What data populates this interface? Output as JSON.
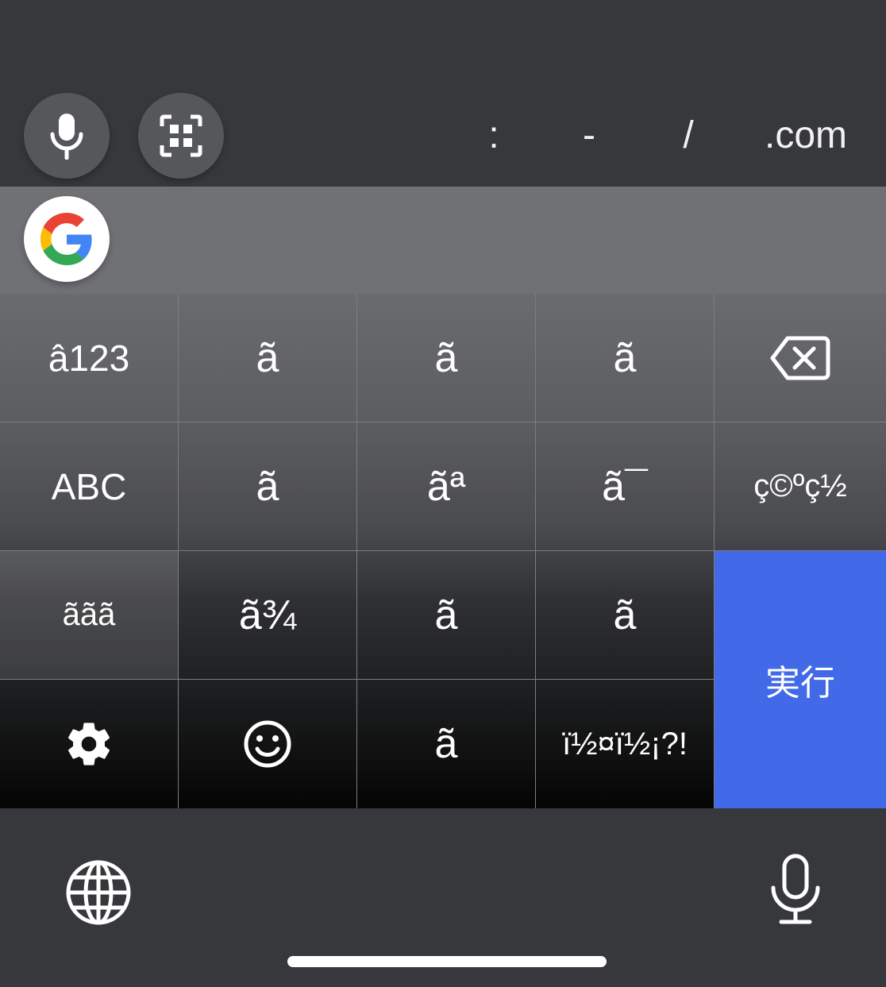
{
  "toolbar": {
    "shortcuts": [
      ":",
      "-",
      "/",
      ".com"
    ]
  },
  "keys": {
    "row1": [
      "â123",
      "ã",
      "ã",
      "ã"
    ],
    "row2": [
      "ABC",
      "ã",
      "ãª",
      "ã¯",
      "ç©ºç½"
    ],
    "row3": [
      "ããã",
      "ã¾",
      "ã",
      "ã"
    ],
    "row4": [
      "ã",
      "ï½¤ï½¡?!"
    ],
    "enter": "実行"
  },
  "colors": {
    "background": "#37383b",
    "suggest_bar": "#707175",
    "enter_key": "#4169e8",
    "circle_button": "#55575b"
  },
  "icons": {
    "toolbar_mic": "microphone-icon",
    "toolbar_scan": "scan-qr-icon",
    "google": "google-logo-icon",
    "backspace": "backspace-icon",
    "settings": "gear-icon",
    "emoji": "emoji-smile-icon",
    "globe": "globe-icon",
    "bottom_mic": "microphone-outline-icon"
  }
}
